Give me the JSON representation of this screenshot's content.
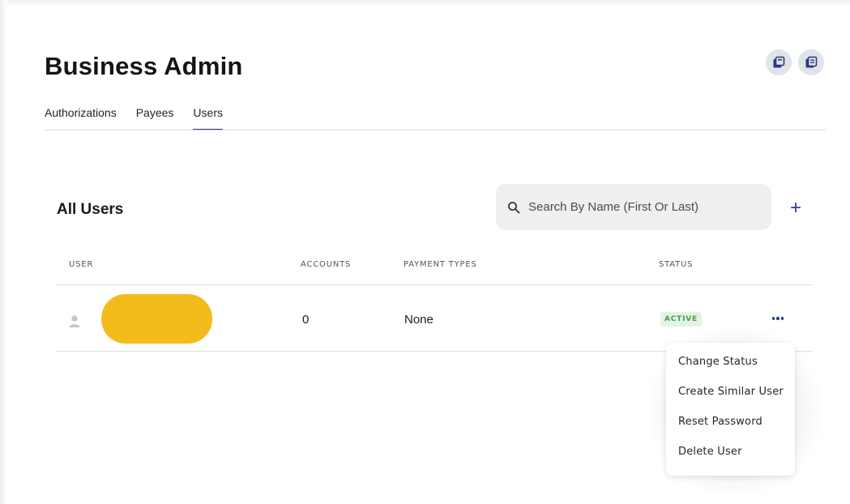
{
  "page": {
    "title": "Business Admin"
  },
  "header_icons": [
    {
      "name": "export-icon"
    },
    {
      "name": "copy-icon"
    }
  ],
  "tabs": [
    {
      "label": "Authorizations",
      "active": false
    },
    {
      "label": "Payees",
      "active": false
    },
    {
      "label": "Users",
      "active": true
    }
  ],
  "users_section": {
    "title": "All Users",
    "search": {
      "placeholder": "Search By Name (First Or Last)",
      "value": ""
    },
    "add_label": "+"
  },
  "table": {
    "columns": [
      "USER",
      "ACCOUNTS",
      "PAYMENT TYPES",
      "STATUS"
    ],
    "rows": [
      {
        "user": "",
        "accounts": "0",
        "payment_types": "None",
        "status": "ACTIVE"
      }
    ]
  },
  "row_menu": {
    "items": [
      {
        "label": "Change Status"
      },
      {
        "label": "Create Similar User"
      },
      {
        "label": "Reset Password"
      },
      {
        "label": "Delete User"
      }
    ]
  },
  "colors": {
    "accent": "#2b3a7a",
    "redaction": "#f3bb1c",
    "status_bg": "#e2f4e2",
    "status_text": "#4c9a4c"
  }
}
